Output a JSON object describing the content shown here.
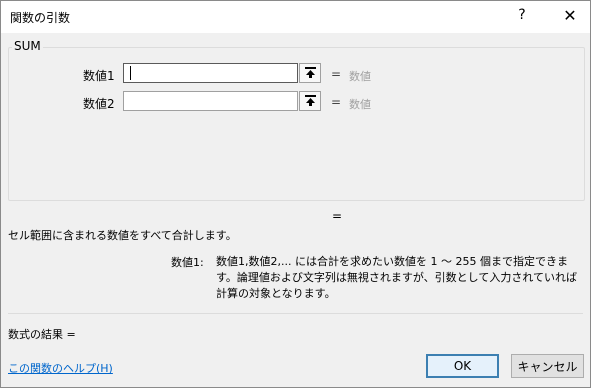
{
  "title_bar": {
    "title": "関数の引数",
    "help_label": "?",
    "close_label": "✕"
  },
  "function": {
    "name": "SUM",
    "args": [
      {
        "label": "数値1",
        "value": "",
        "equals": "=",
        "result": "数値"
      },
      {
        "label": "数値2",
        "value": "",
        "equals": "=",
        "result": "数値"
      }
    ],
    "result_equals": "=",
    "description": "セル範囲に含まれる数値をすべて合計します。",
    "arg_desc_label": "数値1:",
    "arg_desc_text": "数値1,数値2,... には合計を求めたい数値を 1 ～ 255 個まで指定できます。論理値および文字列は無視されますが、引数として入力されていれば計算の対象となります。"
  },
  "footer": {
    "formula_result": "数式の結果 =",
    "help_link": "この関数のヘルプ(H)",
    "ok_label": "OK",
    "cancel_label": "キャンセル"
  },
  "icons": {
    "collapse": "collapse-dialog-icon"
  }
}
